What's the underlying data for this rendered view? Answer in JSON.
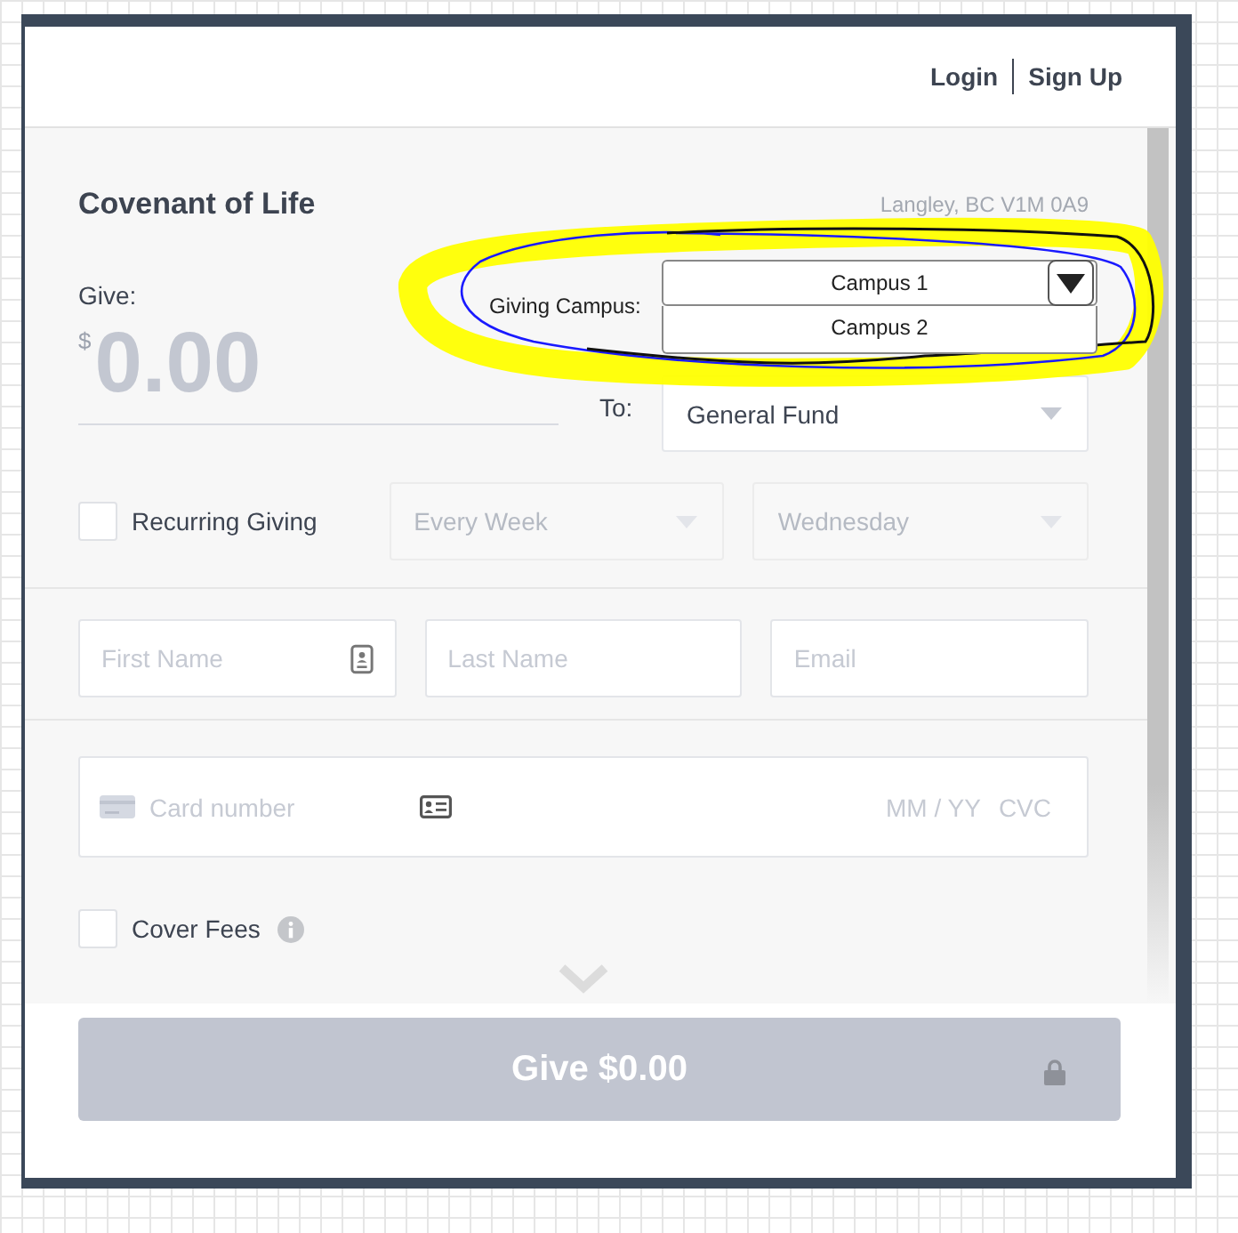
{
  "header": {
    "links": [
      {
        "label": "Login"
      },
      {
        "label": "Sign Up"
      }
    ]
  },
  "organization": {
    "name": "Covenant of Life",
    "location": "Langley, BC V1M 0A9"
  },
  "amount": {
    "label": "Give:",
    "currency": "$",
    "value": "0.00"
  },
  "campus": {
    "label": "Giving Campus:",
    "value": "Campus 1",
    "expanded": true,
    "options": [
      "Campus 2"
    ]
  },
  "fund": {
    "label": "To:",
    "value": "General Fund"
  },
  "recurring": {
    "label": "Recurring Giving",
    "checked": false,
    "frequency": {
      "value": "Every Week",
      "disabled": true
    },
    "day": {
      "value": "Wednesday",
      "disabled": true
    }
  },
  "contact_fields": [
    {
      "placeholder": "First Name",
      "kind": "contact"
    },
    {
      "placeholder": "Last Name",
      "kind": "plain"
    },
    {
      "placeholder": "Email",
      "kind": "plain"
    }
  ],
  "card": {
    "placeholder": "Card number",
    "expiry_placeholder": "MM / YY",
    "cvc_placeholder": "CVC"
  },
  "cover_fees": {
    "label": "Cover Fees",
    "checked": false
  },
  "submit": {
    "label": "Give $0.00",
    "disabled": true
  }
}
